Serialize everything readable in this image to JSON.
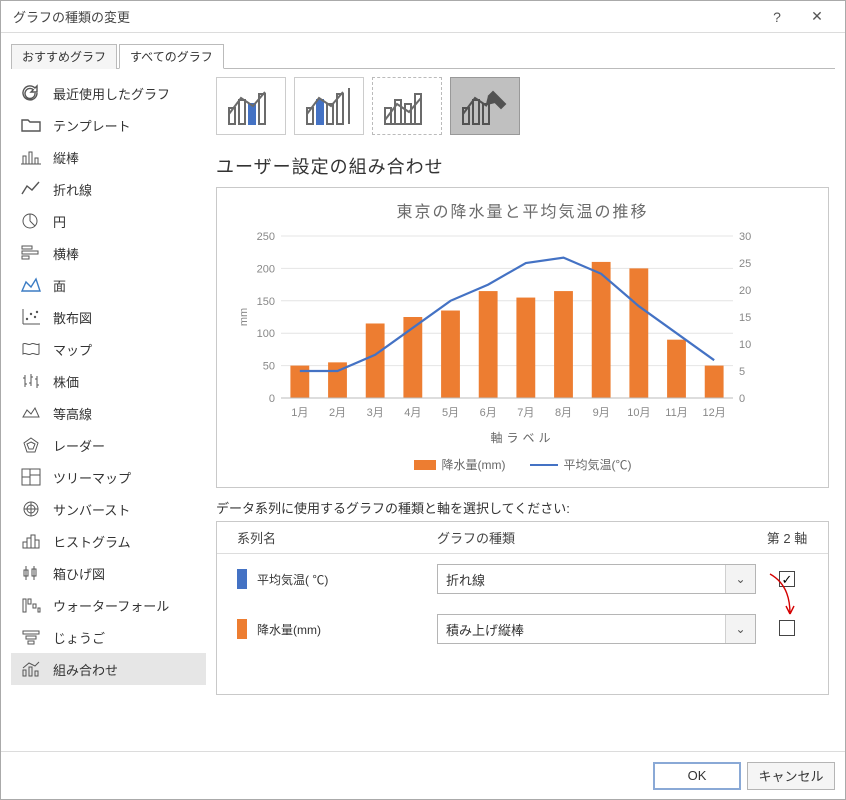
{
  "window": {
    "title": "グラフの種類の変更"
  },
  "tabs": {
    "recommended": "おすすめグラフ",
    "all": "すべてのグラフ"
  },
  "sidebar": {
    "items": [
      {
        "label": "最近使用したグラフ"
      },
      {
        "label": "テンプレート"
      },
      {
        "label": "縦棒"
      },
      {
        "label": "折れ線"
      },
      {
        "label": "円"
      },
      {
        "label": "横棒"
      },
      {
        "label": "面"
      },
      {
        "label": "散布図"
      },
      {
        "label": "マップ"
      },
      {
        "label": "株価"
      },
      {
        "label": "等高線"
      },
      {
        "label": "レーダー"
      },
      {
        "label": "ツリーマップ"
      },
      {
        "label": "サンバースト"
      },
      {
        "label": "ヒストグラム"
      },
      {
        "label": "箱ひげ図"
      },
      {
        "label": "ウォーターフォール"
      },
      {
        "label": "じょうご"
      },
      {
        "label": "組み合わせ"
      }
    ]
  },
  "main": {
    "section_title": "ユーザー設定の組み合わせ",
    "chart_title": "東京の降水量と平均気温の推移",
    "axis_label": "軸ラベル",
    "legend_precip": "降水量(mm)",
    "legend_temp": "平均気温(℃)",
    "series_prompt": "データ系列に使用するグラフの種類と軸を選択してください:",
    "headers": {
      "name": "系列名",
      "type": "グラフの種類",
      "axis2": "第 2 軸"
    },
    "series": [
      {
        "name": "平均気温( ℃)",
        "type": "折れ線",
        "axis2": true
      },
      {
        "name": "降水量(mm)",
        "type": "積み上げ縦棒",
        "axis2": false
      }
    ]
  },
  "footer": {
    "ok": "OK",
    "cancel": "キャンセル"
  },
  "chart_data": {
    "type": "bar+line",
    "categories": [
      "1月",
      "2月",
      "3月",
      "4月",
      "5月",
      "6月",
      "7月",
      "8月",
      "9月",
      "10月",
      "11月",
      "12月"
    ],
    "series": [
      {
        "name": "降水量(mm)",
        "type": "bar",
        "axis": "left",
        "values": [
          50,
          55,
          115,
          125,
          135,
          165,
          155,
          165,
          210,
          200,
          90,
          50
        ]
      },
      {
        "name": "平均気温(℃)",
        "type": "line",
        "axis": "right",
        "values": [
          5,
          5,
          8,
          13,
          18,
          21,
          25,
          26,
          23,
          17,
          12,
          7
        ]
      }
    ],
    "title": "東京の降水量と平均気温の推移",
    "ylabel_left": "mm",
    "ylim_left": [
      0,
      250
    ],
    "ylim_right": [
      0,
      30
    ],
    "xlabel": "軸ラベル"
  }
}
